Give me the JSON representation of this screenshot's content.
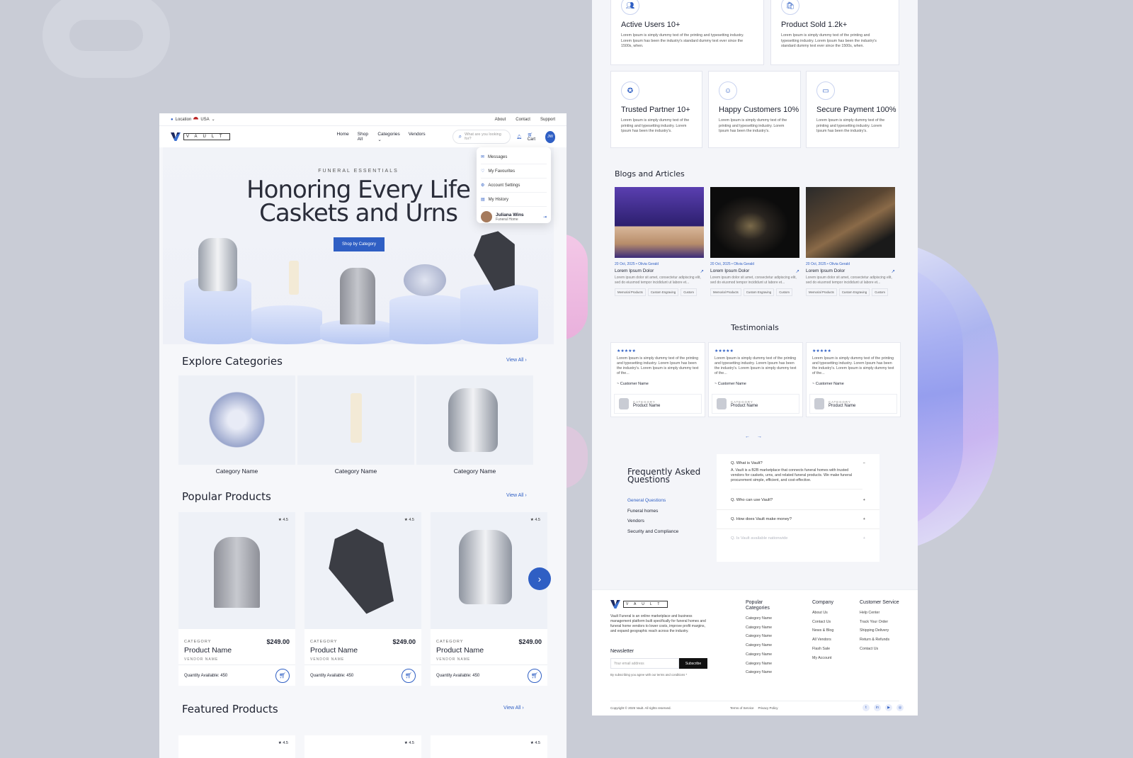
{
  "left": {
    "topbar": {
      "location_label": "Location",
      "country": "USA",
      "links": [
        "About",
        "Contact",
        "Support"
      ]
    },
    "nav": {
      "brand": "VAULT",
      "menu": [
        "Home",
        "Shop All",
        "Categories",
        "Vendors"
      ],
      "search_placeholder": "What are you looking for?",
      "cart_label": "Cart",
      "avatar_initials": "JW"
    },
    "dropdown": {
      "items": [
        "Messages",
        "My Favourites",
        "Account Settings",
        "My History"
      ],
      "user_name": "Juliana Wins",
      "user_role": "Funeral Home"
    },
    "hero": {
      "eyebrow": "FUNERAL ESSENTIALS",
      "title_line1": "Honoring Every Life",
      "title_line2": "Caskets and Urns",
      "cta": "Shop by Category"
    },
    "explore": {
      "title": "Explore Categories",
      "view_all": "View All",
      "items": [
        "Category Name",
        "Category Name",
        "Category Name"
      ]
    },
    "popular": {
      "title": "Popular Products",
      "view_all": "View All",
      "products": [
        {
          "rating": "★ 4.5",
          "category": "CATEGORY",
          "name": "Product Name",
          "price": "$249.00",
          "vendor": "VENDOR NAME",
          "qty": "Quantity Available: 450"
        },
        {
          "rating": "★ 4.5",
          "category": "CATEGORY",
          "name": "Product Name",
          "price": "$249.00",
          "vendor": "VENDOR NAME",
          "qty": "Quantity Available: 450"
        },
        {
          "rating": "★ 4.5",
          "category": "CATEGORY",
          "name": "Product Name",
          "price": "$249.00",
          "vendor": "VENDOR NAME",
          "qty": "Quantity Available: 450"
        }
      ]
    },
    "featured": {
      "title": "Featured Products",
      "view_all": "View All",
      "ratings": [
        "★ 4.5",
        "★ 4.5",
        "★ 4.5"
      ]
    }
  },
  "right": {
    "stats": [
      {
        "icon": "users-icon",
        "title": "Active Users 10+",
        "desc": "Lorem Ipsum is simply dummy text of the printing and typesetting industry. Lorem Ipsum has been the industry's standard dummy text ever since the 1500s, when."
      },
      {
        "icon": "bag-icon",
        "title": "Product Sold 1.2k+",
        "desc": "Lorem Ipsum is simply dummy text of the printing and typesetting industry. Lorem Ipsum has been the industry's standard dummy text ever since the 1500s, when."
      },
      {
        "icon": "badge-icon",
        "title": "Trusted Partner 10+",
        "desc": "Lorem Ipsum is simply dummy text of the printing and typesetting industry. Lorem Ipsum has been the industry's."
      },
      {
        "icon": "smile-icon",
        "title": "Happy Customers 10%",
        "desc": "Lorem Ipsum is simply dummy text of the printing and typesetting industry. Lorem Ipsum has been the industry's."
      },
      {
        "icon": "card-icon",
        "title": "Secure Payment 100%",
        "desc": "Lorem Ipsum is simply dummy text of the printing and typesetting industry. Lorem Ipsum has been the industry's."
      }
    ],
    "blogs": {
      "title": "Blogs and Articles",
      "items": [
        {
          "date": "20 Oct, 2025",
          "author": "Olivia Gerald",
          "title": "Lorem Ipsum Dolor",
          "desc": "Lorem ipsum dolor sit amet, consectetur adipiscing elit, sed do eiusmod tempor incididunt ut labore et...",
          "tags": [
            "Memorial Products",
            "Custom Engraving",
            "Custom"
          ]
        },
        {
          "date": "20 Oct, 2025",
          "author": "Olivia Gerald",
          "title": "Lorem Ipsum Dolor",
          "desc": "Lorem ipsum dolor sit amet, consectetur adipiscing elit, sed do eiusmod tempor incididunt ut labore et...",
          "tags": [
            "Memorial Products",
            "Custom Engraving",
            "Custom"
          ]
        },
        {
          "date": "20 Oct, 2025",
          "author": "Olivia Gerald",
          "title": "Lorem Ipsum Dolor",
          "desc": "Lorem ipsum dolor sit amet, consectetur adipiscing elit, sed do eiusmod tempor incididunt ut labore et...",
          "tags": [
            "Memorial Products",
            "Custom Engraving",
            "Custom"
          ]
        }
      ]
    },
    "testimonials": {
      "title": "Testimonials",
      "items": [
        {
          "stars": "★★★★★",
          "text": "Lorem Ipsum is simply dummy text of the printing and typesetting industry. Lorem Ipsum has been the industry's. Lorem Ipsum is simply dummy text of the...",
          "who": "~ Customer Name",
          "category": "CATEGORY",
          "product": "Product Name"
        },
        {
          "stars": "★★★★★",
          "text": "Lorem Ipsum is simply dummy text of the printing and typesetting industry. Lorem Ipsum has been the industry's. Lorem Ipsum is simply dummy text of the...",
          "who": "~ Customer Name",
          "category": "CATEGORY",
          "product": "Product Name"
        },
        {
          "stars": "★★★★★",
          "text": "Lorem Ipsum is simply dummy text of the printing and typesetting industry. Lorem Ipsum has been the industry's. Lorem Ipsum is simply dummy text of the...",
          "who": "~ Customer Name",
          "category": "CATEGORY",
          "product": "Product Name"
        }
      ],
      "prev": "←",
      "next": "→"
    },
    "faq": {
      "title_line1": "Frequently Asked",
      "title_line2": "Questions",
      "categories": [
        "General Questions",
        "Funeral homes",
        "Vendors",
        "Security and Compliance"
      ],
      "open_q": "Q. What is Vault?",
      "open_a": "A. Vault is a B2B marketplace that connects funeral homes with trusted vendors for caskets, urns, and related funeral products. We make funeral procurement simple, efficient, and cost-effective.",
      "questions": [
        "Q. Who can use Vault?",
        "Q. How does Vault make money?",
        "Q. Is Vault available nationwide"
      ]
    },
    "footer": {
      "brand": "VAULT",
      "about": "Vault Funeral is an online marketplace and business management platform built specifically for funeral homes and funeral home vendors to lower costs, improve profit margins, and expand geographic reach across the industry.",
      "newsletter": "Newsletter",
      "email_placeholder": "Your email address",
      "subscribe": "Subscribe",
      "consent": "By subscribing you agree with our terms and conditions *",
      "popular_title": "Popular Categories",
      "popular_items": [
        "Category Name",
        "Category Name",
        "Category Name",
        "Category Name",
        "Category Name",
        "Category Name",
        "Category Name"
      ],
      "company_title": "Company",
      "company_items": [
        "About Us",
        "Contact Us",
        "News & Blog",
        "All Vendors",
        "Flash Sale",
        "My Account"
      ],
      "service_title": "Customer Service",
      "service_items": [
        "Help Center",
        "Track Your Order",
        "Shipping Delivery",
        "Return & Refunds",
        "Contact Us"
      ],
      "copyright": "Copyright © 2025 Vault. All rights reserved.",
      "terms": "Terms of Service",
      "privacy": "Privacy Policy",
      "social": [
        "t",
        "in",
        "▶",
        "◎"
      ]
    }
  }
}
